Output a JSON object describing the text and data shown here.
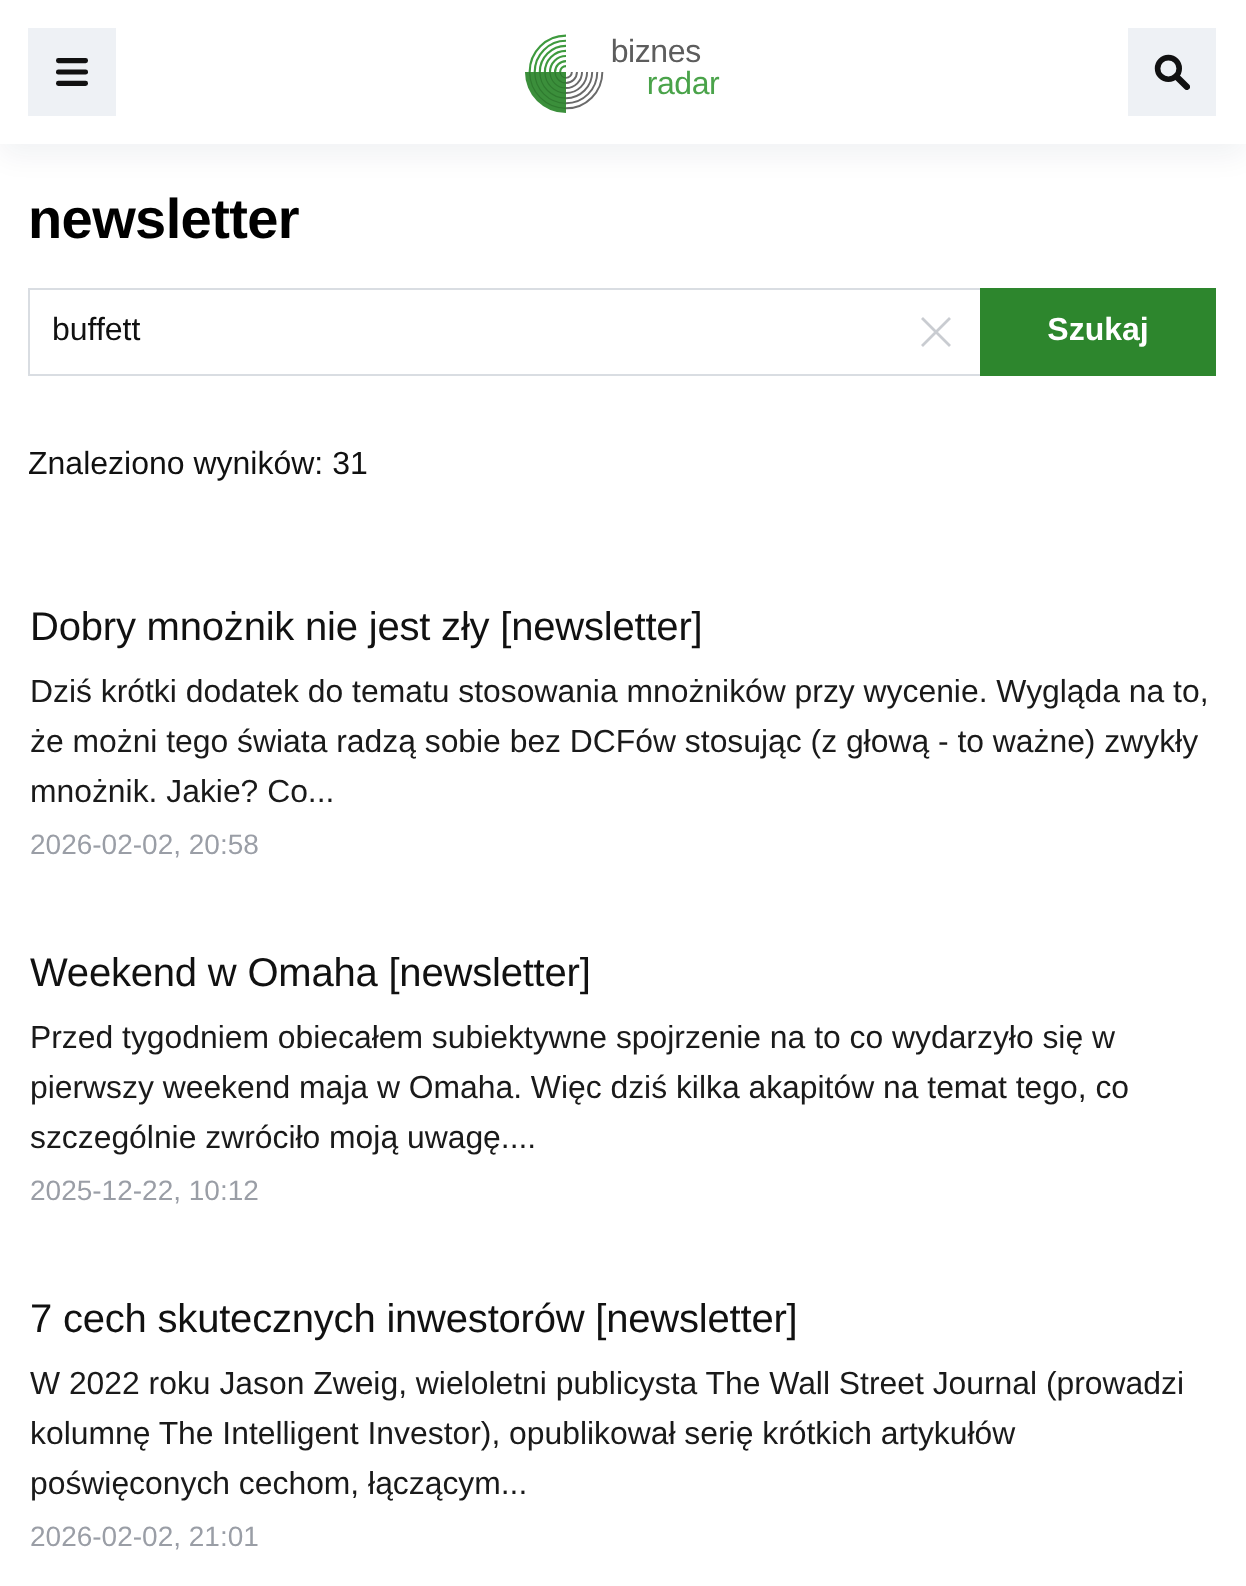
{
  "header": {
    "logo": {
      "top": "biznes",
      "bottom": "radar"
    }
  },
  "page_title": "newsletter",
  "search": {
    "value": "buffett",
    "button": "Szukaj"
  },
  "results_count": "Znaleziono wyników: 31",
  "articles": [
    {
      "title": "Dobry mnożnik nie jest zły [newsletter]",
      "excerpt": "Dziś krótki dodatek do tematu stosowania mnożników przy wycenie. Wygląda na to, że możni tego świata radzą sobie bez DCFów stosując (z głową - to ważne) zwykły mnożnik. Jakie? Co...",
      "date": "2026-02-02, 20:58"
    },
    {
      "title": "Weekend w Omaha [newsletter]",
      "excerpt": "Przed tygodniem obiecałem subiektywne spojrzenie na to co wydarzyło się w pierwszy weekend maja w Omaha. Więc dziś kilka akapitów na temat tego, co szczególnie zwróciło moją uwagę....",
      "date": "2025-12-22, 10:12"
    },
    {
      "title": "7 cech skutecznych inwestorów [newsletter]",
      "excerpt": "W 2022 roku Jason Zweig, wieloletni publicysta The Wall Street Journal (prowadzi kolumnę The Intelligent Investor), opublikował serię krótkich artykułów poświęconych cechom, łączącym...",
      "date": "2026-02-02, 21:01"
    }
  ]
}
